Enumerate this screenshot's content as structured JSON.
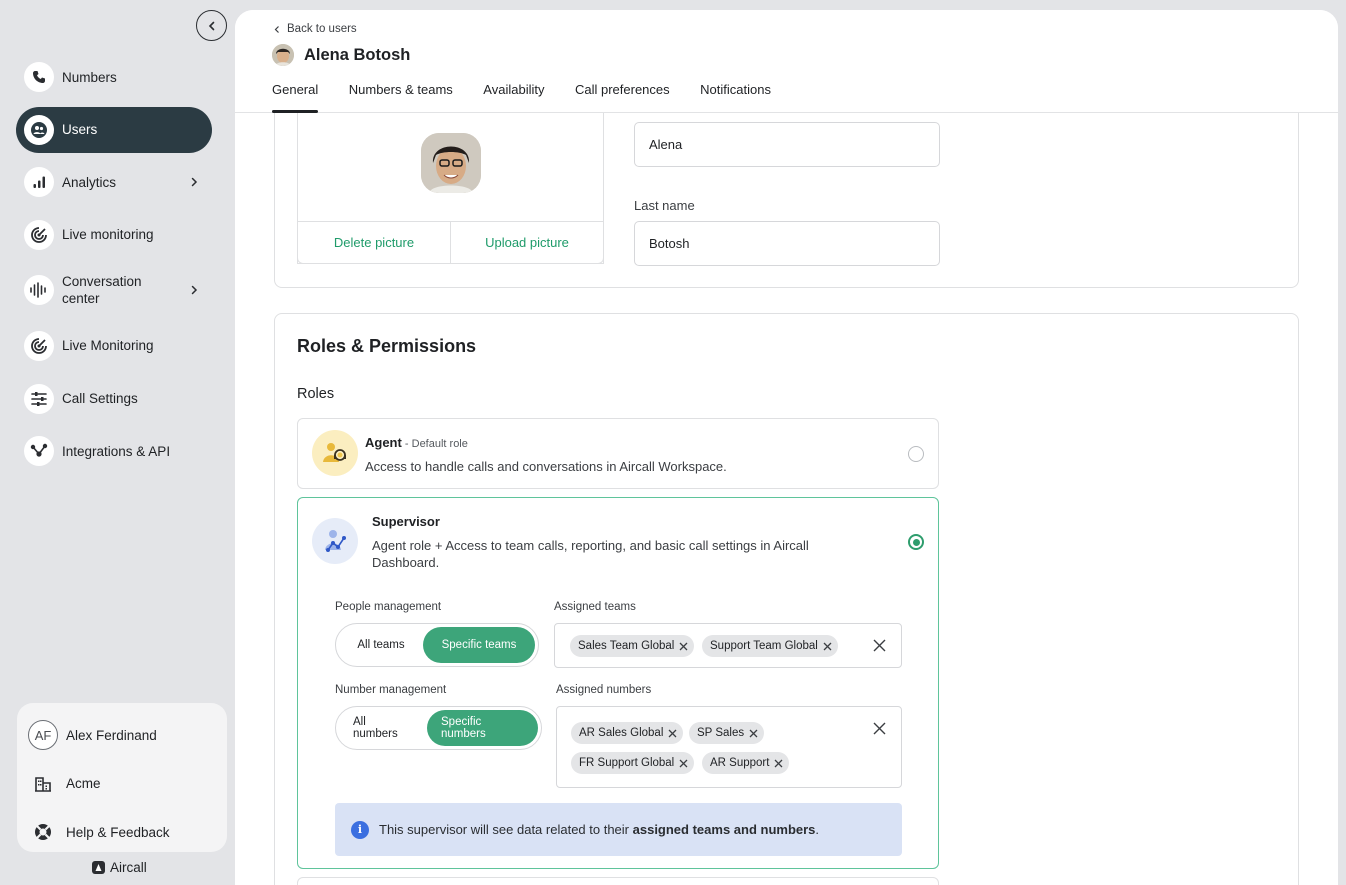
{
  "sidebar": {
    "items": [
      {
        "label": "Numbers",
        "icon": "phone-icon"
      },
      {
        "label": "Users",
        "icon": "users-icon"
      },
      {
        "label": "Analytics",
        "icon": "bar-chart-icon"
      },
      {
        "label": "Live monitoring",
        "icon": "live-icon"
      },
      {
        "label": "Conversation center",
        "icon": "waveform-icon"
      },
      {
        "label": "Live Monitoring",
        "icon": "live-icon"
      },
      {
        "label": "Call Settings",
        "icon": "sliders-icon"
      },
      {
        "label": "Integrations & API",
        "icon": "integrations-icon"
      }
    ],
    "account": {
      "initials": "AF",
      "name": "Alex Ferdinand",
      "company": "Acme",
      "help": "Help & Feedback"
    },
    "brand": "Aircall"
  },
  "header": {
    "back_label": "Back to users",
    "title": "Alena Botosh",
    "tabs": [
      "General",
      "Numbers & teams",
      "Availability",
      "Call preferences",
      "Notifications"
    ]
  },
  "profile": {
    "delete_picture": "Delete picture",
    "upload_picture": "Upload picture",
    "first_name_value": "Alena",
    "last_name_label": "Last name",
    "last_name_value": "Botosh"
  },
  "roles": {
    "section_title": "Roles & Permissions",
    "roles_label": "Roles",
    "agent": {
      "name": "Agent",
      "sub": " - Default role",
      "desc": "Access to handle calls and conversations in Aircall Workspace."
    },
    "supervisor": {
      "name": "Supervisor",
      "desc": "Agent role + Access to team calls, reporting, and basic call settings in Aircall Dashboard.",
      "people_label": "People management",
      "people_options": [
        "All teams",
        "Specific teams"
      ],
      "teams_label": "Assigned teams",
      "teams": [
        "Sales Team Global",
        "Support Team Global"
      ],
      "number_label": "Number management",
      "number_options": [
        "All numbers",
        "Specific numbers"
      ],
      "numbers_label": "Assigned numbers",
      "numbers": [
        "AR Sales Global",
        "SP Sales",
        "FR Support Global",
        "AR Support"
      ],
      "info_prefix": "This supervisor will see data related to their ",
      "info_bold": "assigned teams and numbers",
      "info_suffix": "."
    }
  }
}
